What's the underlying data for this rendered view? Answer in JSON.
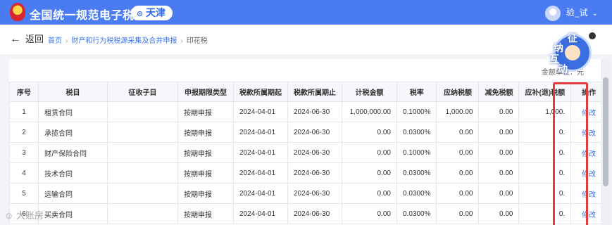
{
  "header": {
    "title": "全国统一规范电子税务局",
    "region": "天津",
    "user": "验_试"
  },
  "nav": {
    "back": "返回",
    "breadcrumbs": [
      "首页",
      "财产和行为税税源采集及合并申报",
      "印花税"
    ]
  },
  "mascot": {
    "chars": [
      "征",
      "纳",
      "互",
      "动"
    ]
  },
  "unit_note": "金额单位：元",
  "table": {
    "headers": [
      "序号",
      "税目",
      "征收子目",
      "申报期限类型",
      "税款所属期起",
      "税款所属期止",
      "计税金额",
      "税率",
      "应纳税额",
      "减免税额",
      "应补(退)税额",
      "操作"
    ],
    "rows": [
      [
        "1",
        "租赁合同",
        "",
        "按期申报",
        "2024-04-01",
        "2024-06-30",
        "1,000,000.00",
        "0.1000%",
        "1,000.00",
        "0.00",
        "1,000.",
        "修改"
      ],
      [
        "2",
        "承揽合同",
        "",
        "按期申报",
        "2024-04-01",
        "2024-06-30",
        "0.00",
        "0.0300%",
        "0.00",
        "0.00",
        "0.",
        "修改"
      ],
      [
        "3",
        "财产保险合同",
        "",
        "按期申报",
        "2024-04-01",
        "2024-06-30",
        "0.00",
        "0.1000%",
        "0.00",
        "0.00",
        "0.",
        "修改"
      ],
      [
        "4",
        "技术合同",
        "",
        "按期申报",
        "2024-04-01",
        "2024-06-30",
        "0.00",
        "0.0300%",
        "0.00",
        "0.00",
        "0.",
        "修改"
      ],
      [
        "5",
        "运输合同",
        "",
        "按期申报",
        "2024-04-01",
        "2024-06-30",
        "0.00",
        "0.0300%",
        "0.00",
        "0.00",
        "0.",
        "修改"
      ],
      [
        "6",
        "买卖合同",
        "",
        "按期申报",
        "2024-04-01",
        "2024-06-30",
        "0.00",
        "0.0300%",
        "0.00",
        "0.00",
        "0.",
        "修改"
      ]
    ]
  },
  "watermark": "大账房"
}
